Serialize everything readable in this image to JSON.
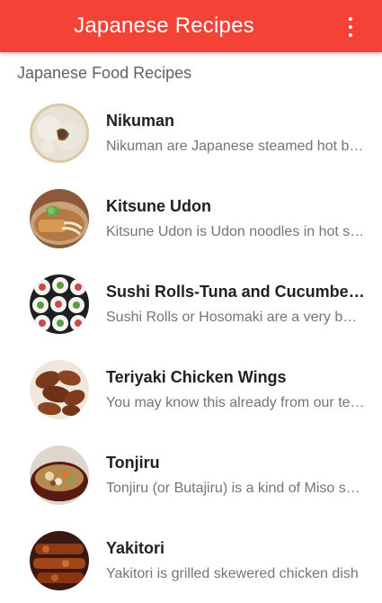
{
  "app": {
    "title": "Japanese Recipes",
    "menu_icon": "more-vert-icon",
    "accent_color": "#f44336"
  },
  "section": {
    "header": "Japanese Food Recipes"
  },
  "recipes": [
    {
      "title": "Nikuman",
      "description": "Nikuman are Japanese steamed hot buns filled with meat",
      "image": "nikuman-photo"
    },
    {
      "title": "Kitsune Udon",
      "description": "Kitsune Udon is Udon noodles in hot soup topped with fried tofu",
      "image": "kitsune-udon-photo"
    },
    {
      "title": "Sushi Rolls-Tuna and Cucumber Rolls",
      "description": "Sushi Rolls or Hosomaki are a very basic sushi",
      "image": "sushi-rolls-photo"
    },
    {
      "title": "Teriyaki Chicken Wings",
      "description": "You may know this already from our teriyaki recipe",
      "image": "teriyaki-wings-photo"
    },
    {
      "title": "Tonjiru",
      "description": "Tonjiru (or Butajiru) is a kind of Miso soup with pork",
      "image": "tonjiru-photo"
    },
    {
      "title": "Yakitori",
      "description": "Yakitori is grilled skewered chicken dish",
      "image": "yakitori-photo"
    }
  ]
}
